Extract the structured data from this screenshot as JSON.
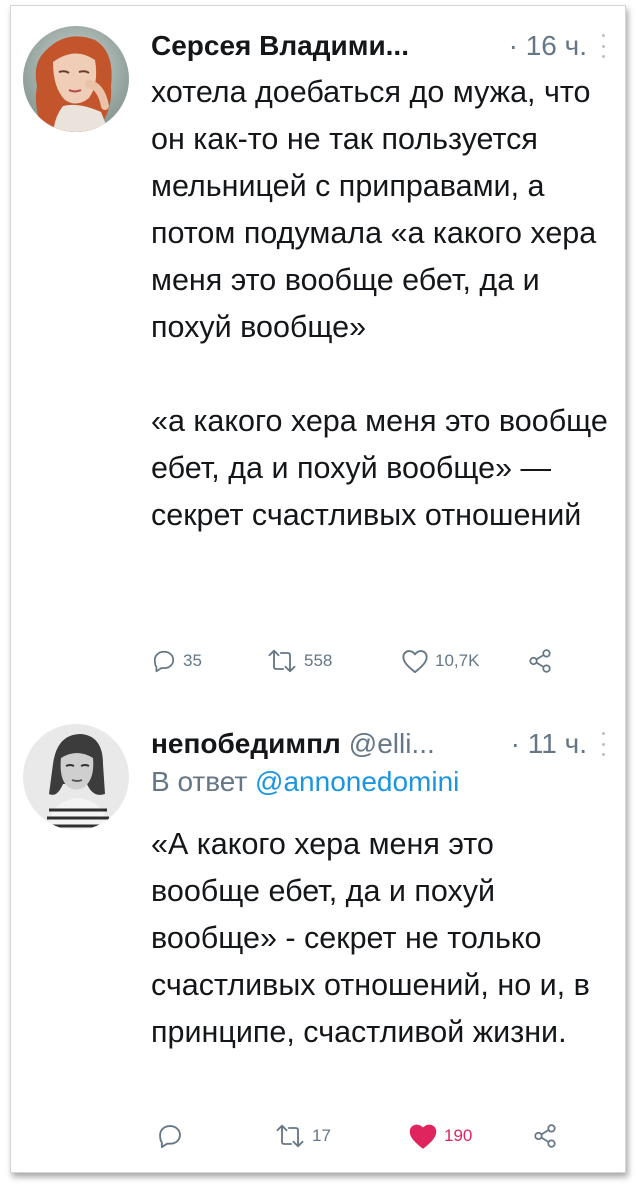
{
  "tweets": [
    {
      "author_name": "Серсея Владими...",
      "handle": "",
      "time": "· 16 ч.",
      "reply_to_prefix": "",
      "reply_to_handle": "",
      "paragraphs": [
        "хотела доебаться до мужа, что он как-то не так пользуется мельницей с приправами, а потом подумала «а какого хера меня это вообще ебет, да и похуй вообще»",
        "«а какого хера меня это вообще ебет, да и похуй вообще» — секрет счастливых отношений"
      ],
      "stats": {
        "replies": "35",
        "retweets": "558",
        "likes": "10,7K"
      },
      "liked": false
    },
    {
      "author_name": "непобедимпл",
      "handle": "@elli...",
      "time": "· 11 ч.",
      "reply_to_prefix": "В ответ",
      "reply_to_handle": "@annonedomini",
      "paragraphs": [
        "«А какого хера меня это вообще ебет, да и похуй вообще» - секрет не только счастливых отношений, но и, в принципе, счастливой жизни."
      ],
      "stats": {
        "replies": "",
        "retweets": "17",
        "likes": "190"
      },
      "liked": true
    }
  ],
  "icons": {
    "reply": "reply-icon",
    "retweet": "retweet-icon",
    "like": "heart-icon",
    "share": "share-icon",
    "menu": "more-vertical-icon"
  },
  "colors": {
    "text": "#14171a",
    "secondary": "#657786",
    "mention": "#1b95e0",
    "like_active": "#e0245e"
  }
}
